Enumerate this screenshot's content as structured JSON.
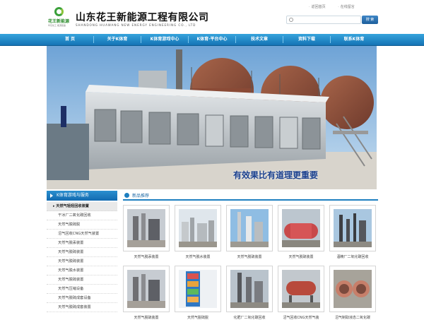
{
  "header": {
    "logo_cn": "花王新能源",
    "logo_sub": "华东化工·能源装备",
    "company_name": "山东花王新能源工程有限公司",
    "company_name_en": "SHANDONG HUAWANG NEW ENERGY ENGINEERING CO., LTD",
    "top_links": [
      "返回首页",
      "在线留言"
    ],
    "search_button": "搜 索"
  },
  "nav": {
    "items": [
      "首 页",
      "关于K体育",
      "K体育游戏中心",
      "K体育·平台中心",
      "技术文章",
      "资料下载",
      "联系K体育"
    ]
  },
  "banner": {
    "slogan": "有效果比有道理更重要"
  },
  "sidebar": {
    "title": "K体育游戏与服务",
    "items": [
      "天然气轻烃回收装置",
      "干冰厂二氧化碳回收",
      "天然气脱硫脱",
      "沼气回收CNG天然气装置",
      "天然气脱汞装置",
      "天然气脱硫装置",
      "天然气脱硫装置",
      "天然气脱水装置",
      "天然气脱硫装置",
      "天然气压缩设备",
      "天然气脱硫成套设备",
      "天然气脱硫成套装置"
    ]
  },
  "main": {
    "section_title": "新品推荐",
    "products": [
      {
        "caption": "天然气脱汞装置"
      },
      {
        "caption": "天然气脱水装置"
      },
      {
        "caption": "天然气脱硫装置"
      },
      {
        "caption": "天然气脱硫装置"
      },
      {
        "caption": "酒精厂二氧化碳回收"
      },
      {
        "caption": "天然气脱硫装置"
      },
      {
        "caption": "天然气脱硫脱"
      },
      {
        "caption": "化肥厂二氧化碳回收"
      },
      {
        "caption": "沼气回收CNG天然气装"
      },
      {
        "caption": "沼气制取液态二氧化碳"
      }
    ]
  },
  "colors": {
    "nav_blue": "#1573b5",
    "banner_slogan": "#1a3f8c",
    "logo_green": "#3aa03a"
  }
}
